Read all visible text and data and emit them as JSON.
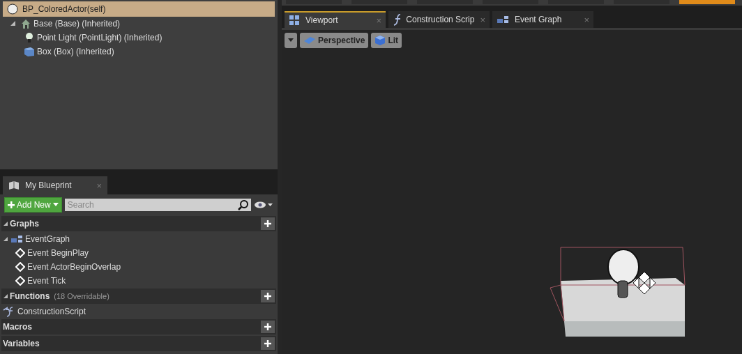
{
  "toolbar": [
    {
      "selected": false
    },
    {
      "selected": false
    },
    {
      "selected": false
    },
    {
      "selected": false
    },
    {
      "selected": false
    },
    {
      "selected": false
    },
    {
      "selected": true
    }
  ],
  "components": {
    "root": {
      "label": "BP_ColoredActor(self)",
      "selected": true
    },
    "items": [
      {
        "label": "Base (Base) (Inherited)",
        "kind": "scene",
        "expanded": true,
        "children": [
          {
            "label": "Point Light (PointLight) (Inherited)",
            "kind": "light"
          },
          {
            "label": "Box (Box) (Inherited)",
            "kind": "box"
          }
        ]
      }
    ]
  },
  "editor_tabs": [
    {
      "label": "Viewport",
      "kind": "viewport",
      "selected": true,
      "close": "×"
    },
    {
      "label": "Construction Scrip",
      "kind": "function",
      "selected": false,
      "close": "×"
    },
    {
      "label": "Event Graph",
      "kind": "graph",
      "selected": false,
      "close": "×"
    }
  ],
  "viewport_toolbar": [
    {
      "label": "Perspective",
      "kind": "perspective"
    },
    {
      "label": "Lit",
      "kind": "lit"
    }
  ],
  "my_blueprint": {
    "tab": {
      "label": "My Blueprint",
      "close": "×"
    },
    "add_new": "Add New",
    "search": {
      "placeholder": "Search"
    },
    "sections": [
      {
        "title": "Graphs",
        "expanded": true,
        "items": [
          {
            "label": "EventGraph",
            "kind": "graph",
            "expanded": true,
            "children": [
              {
                "label": "Event BeginPlay",
                "kind": "event"
              },
              {
                "label": "Event ActorBeginOverlap",
                "kind": "event"
              },
              {
                "label": "Event Tick",
                "kind": "event"
              }
            ]
          }
        ]
      },
      {
        "title": "Functions",
        "note": "(18 Overridable)",
        "expanded": true,
        "items": [
          {
            "label": "ConstructionScript",
            "kind": "function"
          }
        ]
      },
      {
        "title": "Macros",
        "expanded": false
      },
      {
        "title": "Variables",
        "expanded": false
      }
    ]
  }
}
